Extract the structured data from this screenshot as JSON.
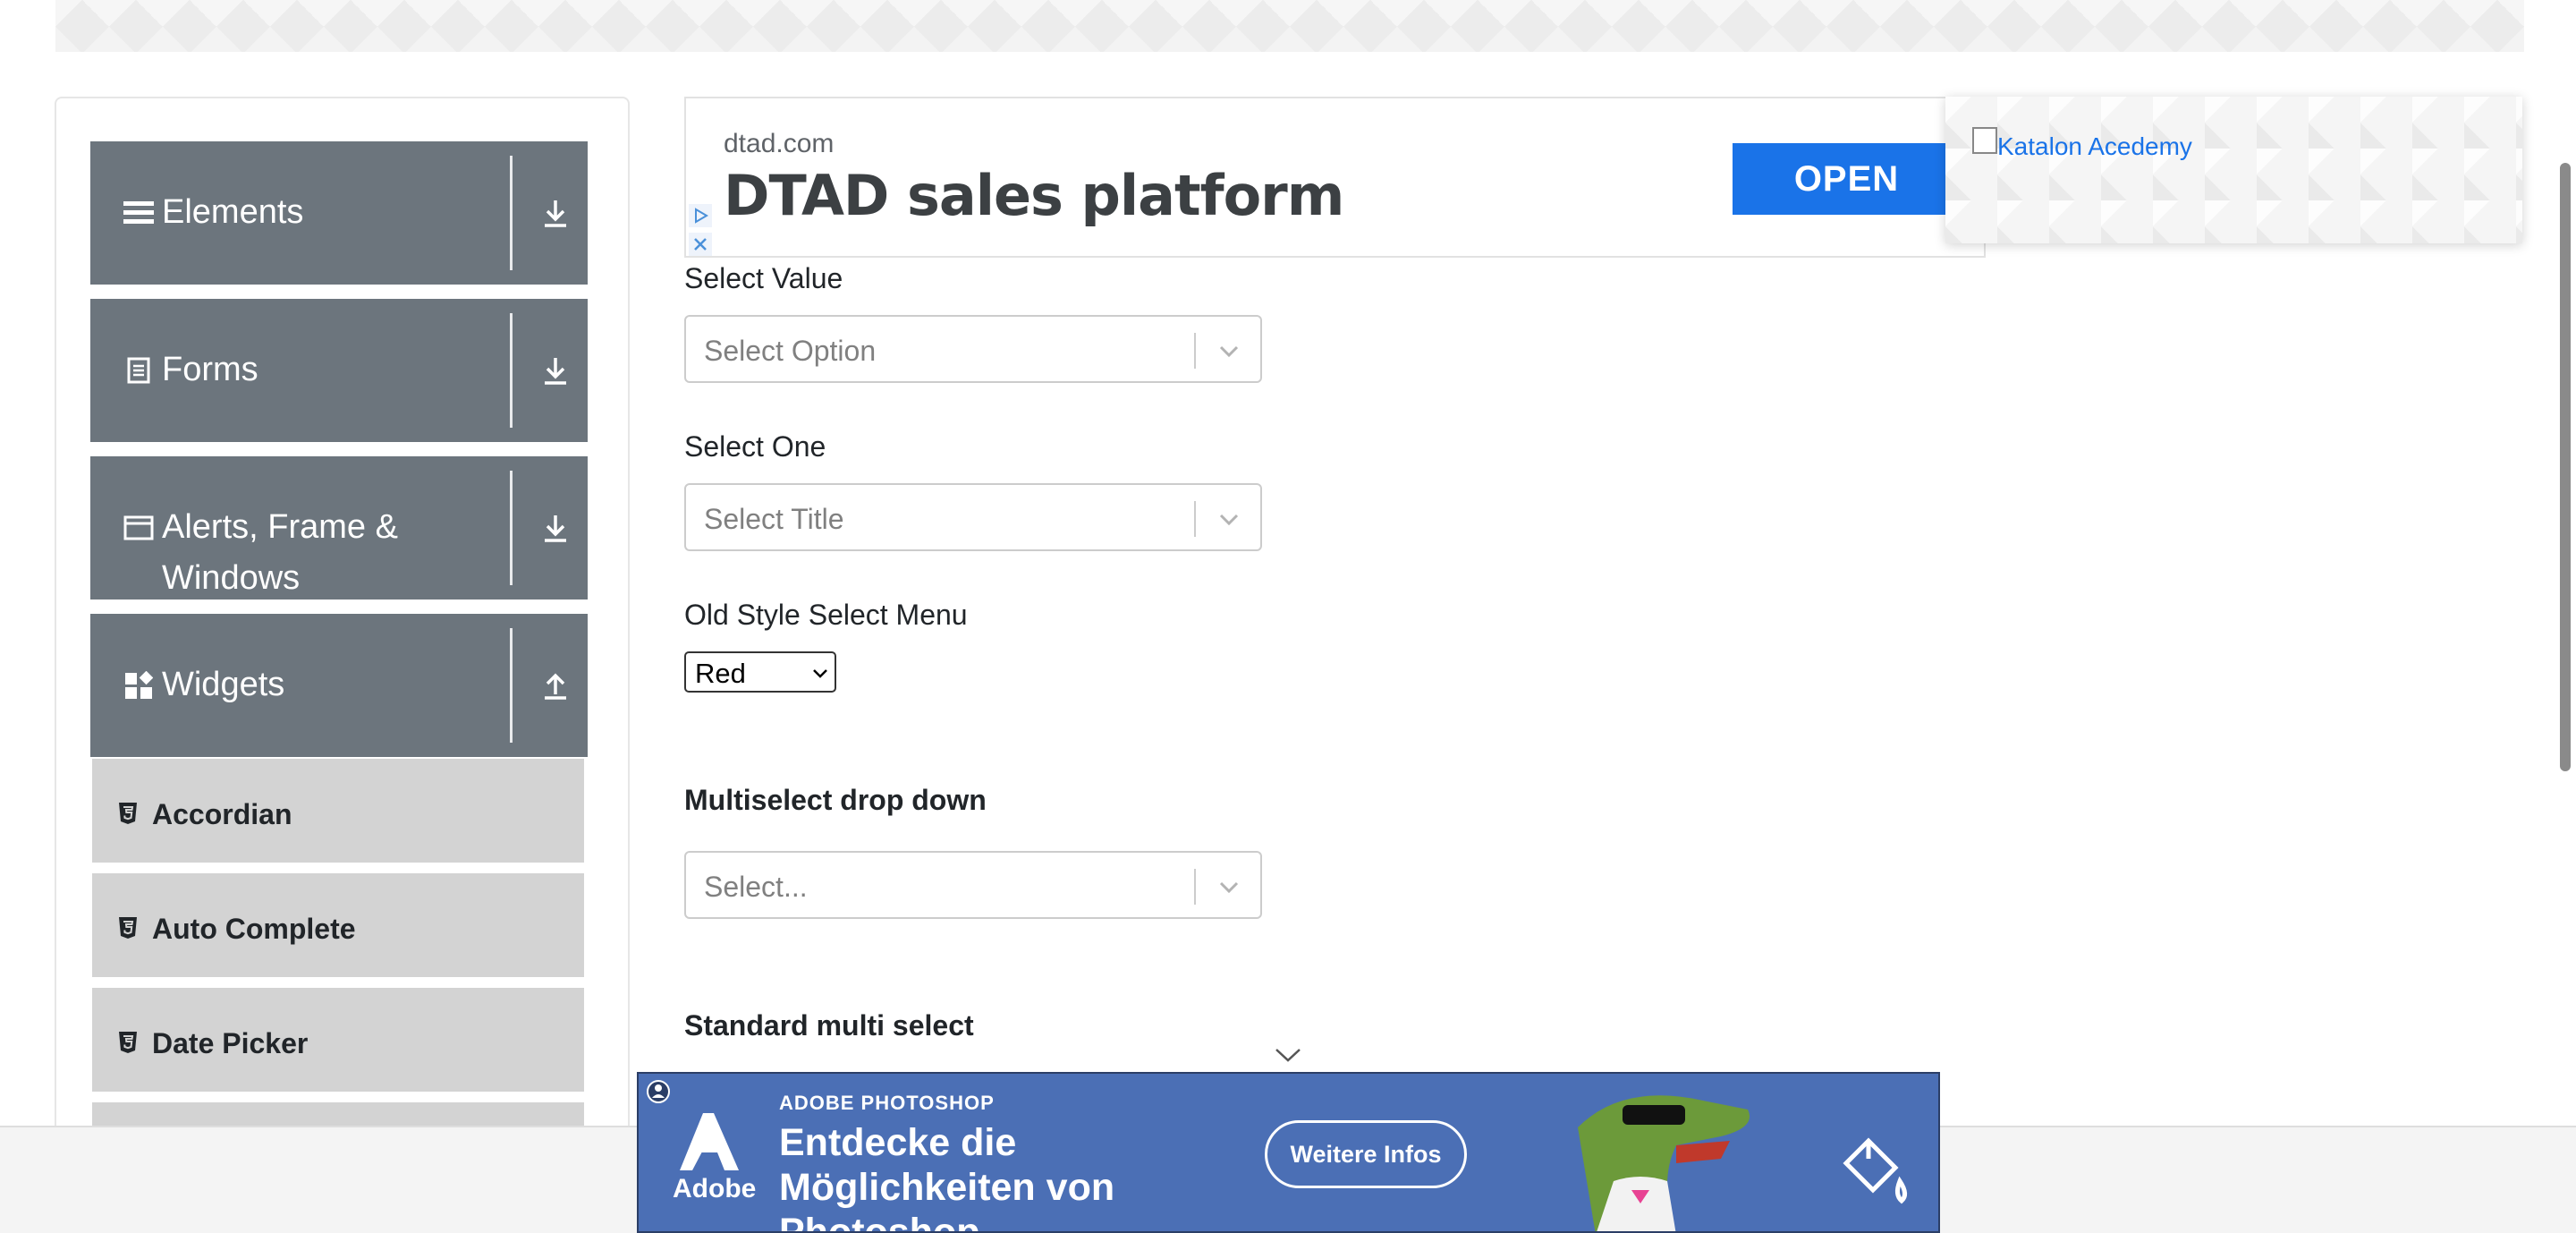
{
  "sidebar": {
    "groups": [
      {
        "label": "Elements",
        "icon": "menu-icon",
        "toggle": "download-icon"
      },
      {
        "label": "Forms",
        "icon": "document-icon",
        "toggle": "download-icon"
      },
      {
        "label_line1": "Alerts, Frame &",
        "label_line2": "Windows",
        "icon": "window-icon",
        "toggle": "download-icon"
      },
      {
        "label": "Widgets",
        "icon": "widgets-icon",
        "toggle": "upload-icon"
      }
    ],
    "widget_items": [
      "Accordian",
      "Auto Complete",
      "Date Picker"
    ]
  },
  "ad": {
    "domain": "dtad.com",
    "title": "DTAD sales platform",
    "button": "OPEN"
  },
  "katalon": {
    "alt": "Katalon Acedemy"
  },
  "form": {
    "select_value_label": "Select Value",
    "select_value_placeholder": "Select Option",
    "select_one_label": "Select One",
    "select_one_placeholder": "Select Title",
    "old_style_label": "Old Style Select Menu",
    "old_style_value": "Red",
    "multiselect_label": "Multiselect drop down",
    "multiselect_placeholder": "Select...",
    "standard_multi_label": "Standard multi select"
  },
  "bottom_ad": {
    "kicker": "ADOBE PHOTOSHOP",
    "headline": "Entdecke die Möglichkeiten von Photoshop.",
    "cta": "Weitere Infos",
    "brand": "Adobe"
  },
  "colors": {
    "sidebar_group_bg": "#6c757d",
    "sidebar_item_bg": "#d3d3d3",
    "ad_button": "#1a73e8",
    "bottom_ad_bg": "#4b6fb5"
  }
}
